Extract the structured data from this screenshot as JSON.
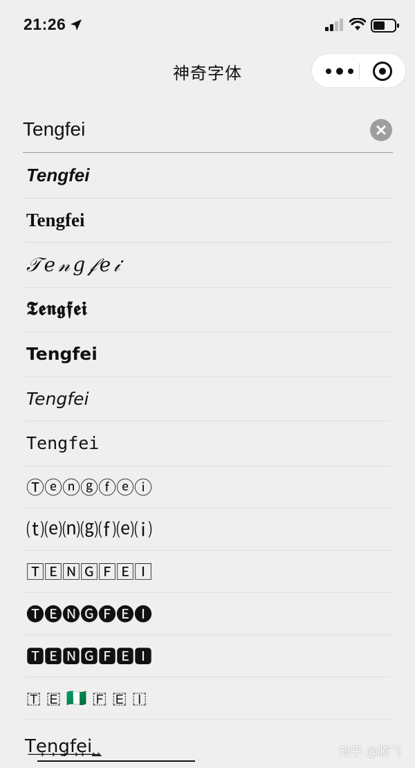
{
  "status": {
    "time": "21:26",
    "icons": [
      "location-arrow-icon",
      "signal-icon",
      "wifi-icon",
      "battery-icon"
    ]
  },
  "nav": {
    "title": "神奇字体",
    "icons": [
      "more-icon",
      "close-circle-icon"
    ]
  },
  "search": {
    "value": "Tengfei",
    "clear_icon": "clear-icon"
  },
  "results": [
    {
      "style": "bold-italic",
      "text": "Tengfei"
    },
    {
      "style": "serif-bold",
      "text": "Tengfei"
    },
    {
      "style": "script",
      "text": "𝒯𝑒𝓃𝑔𝒻𝑒𝒾"
    },
    {
      "style": "fraktur",
      "text": "𝕿𝖊𝖓𝖌𝖋𝖊𝖎"
    },
    {
      "style": "sans-bold",
      "text": "Tengfei"
    },
    {
      "style": "sans-italic",
      "text": "Tengfei"
    },
    {
      "style": "monospace",
      "text": "Tengfei"
    },
    {
      "style": "circled",
      "text": "Ⓣⓔⓝⓖⓕⓔⓘ"
    },
    {
      "style": "parenthesized",
      "text": "⒯⒠⒩⒢⒡⒠⒤"
    },
    {
      "style": "squared",
      "text": "🅃🄴🄽🄶🄵🄴🄸"
    },
    {
      "style": "negative-circled",
      "text": "🅣🅔🅝🅖🅕🅔🅘"
    },
    {
      "style": "negative-squared",
      "text": "🆃🅴🅽🅶🅵🅴🅸"
    },
    {
      "style": "regional-indicator",
      "text": "🇹 🇪 🇳🇬 🇫 🇪 🇮"
    },
    {
      "style": "ring-underline",
      "text": "T͢e͢n͢g͢f͢e͢i͢_"
    }
  ],
  "watermark": "知乎 @腾飞"
}
